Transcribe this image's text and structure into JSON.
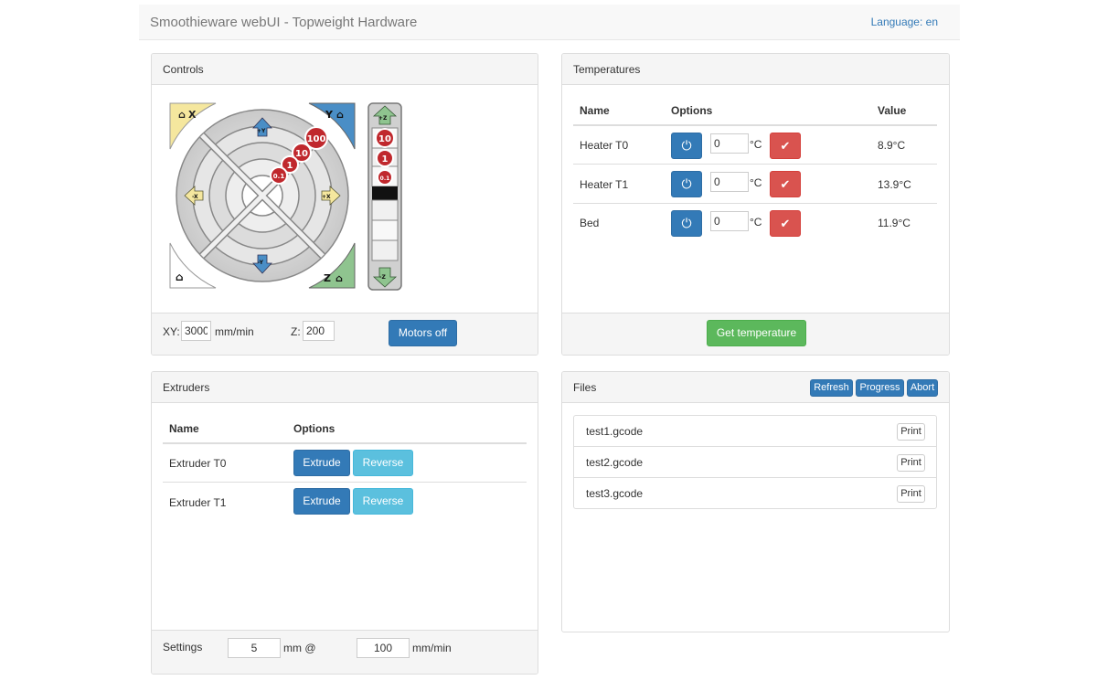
{
  "app": {
    "title": "Smoothieware webUI - Topweight Hardware",
    "language_label": "Language: en"
  },
  "controls": {
    "title": "Controls",
    "jog": {
      "home_x": "X",
      "home_y": "Y",
      "home_z": "Z",
      "plus_y": "+Y",
      "minus_y": "-Y",
      "plus_x": "+X",
      "minus_x": "-X",
      "plus_z": "+Z",
      "minus_z": "-Z",
      "steps": [
        "100",
        "10",
        "1",
        "0.1"
      ],
      "z_steps": [
        "10",
        "1",
        "0.1"
      ]
    },
    "xy_label": "XY:",
    "xy_value": "3000",
    "xy_unit": "mm/min",
    "z_label": "Z:",
    "z_value": "200",
    "motors_off": "Motors off"
  },
  "temperatures": {
    "title": "Temperatures",
    "headers": {
      "name": "Name",
      "options": "Options",
      "value": "Value"
    },
    "unit": "°C",
    "rows": [
      {
        "name": "Heater T0",
        "setpoint": "0",
        "value": "8.9°C"
      },
      {
        "name": "Heater T1",
        "setpoint": "0",
        "value": "13.9°C"
      },
      {
        "name": "Bed",
        "setpoint": "0",
        "value": "11.9°C"
      }
    ],
    "get_temperature": "Get temperature"
  },
  "extruders": {
    "title": "Extruders",
    "headers": {
      "name": "Name",
      "options": "Options"
    },
    "rows": [
      {
        "name": "Extruder T0",
        "extrude": "Extrude",
        "reverse": "Reverse"
      },
      {
        "name": "Extruder T1",
        "extrude": "Extrude",
        "reverse": "Reverse"
      }
    ],
    "settings_label": "Settings",
    "length_value": "5",
    "length_unit": "mm @",
    "speed_value": "100",
    "speed_unit": "mm/min"
  },
  "files": {
    "title": "Files",
    "refresh": "Refresh",
    "progress": "Progress",
    "abort": "Abort",
    "items": [
      {
        "name": "test1.gcode",
        "action": "Print"
      },
      {
        "name": "test2.gcode",
        "action": "Print"
      },
      {
        "name": "test3.gcode",
        "action": "Print"
      }
    ]
  },
  "colors": {
    "primary": "#337ab7",
    "success": "#5cb85c",
    "danger": "#d9534f",
    "info": "#5bc0de",
    "jog_x_yellow": "#f5e79e",
    "jog_y_blue": "#4a8ec6",
    "jog_z_green": "#8fc48f",
    "step_red": "#c0282d"
  }
}
